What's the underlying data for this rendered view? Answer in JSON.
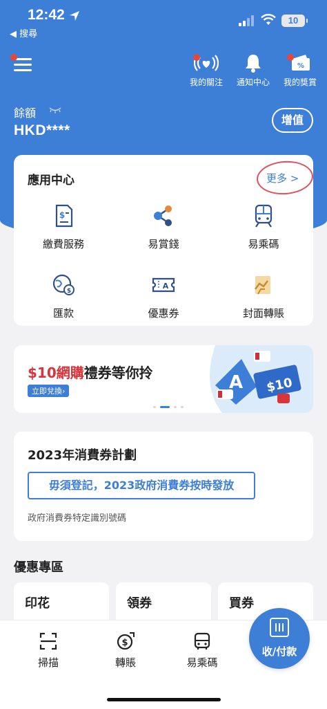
{
  "status_bar": {
    "time": "12:42",
    "back_label": "◀ 搜尋",
    "battery": "10"
  },
  "header": {
    "items": [
      {
        "label": "我的關注",
        "icon": "heart-broadcast-icon"
      },
      {
        "label": "通知中心",
        "icon": "bell-icon"
      },
      {
        "label": "我的獎賞",
        "icon": "coupon-icon"
      }
    ]
  },
  "balance": {
    "label": "餘額",
    "value": "HKD****",
    "topup_label": "增值"
  },
  "app_center": {
    "title": "應用中心",
    "more_label": "更多 >",
    "items": [
      {
        "label": "繳費服務",
        "icon": "bill-icon"
      },
      {
        "label": "易賞錢",
        "icon": "share-nodes-icon"
      },
      {
        "label": "易乘碼",
        "icon": "train-icon"
      },
      {
        "label": "匯款",
        "icon": "globe-money-icon"
      },
      {
        "label": "優惠券",
        "icon": "ticket-icon"
      },
      {
        "label": "封面轉賬",
        "icon": "envelope-transfer-icon"
      }
    ]
  },
  "banner": {
    "title_highlight": "$10網購",
    "title_rest": "禮券等你拎",
    "tag": "立即兌換›",
    "art_text": "$10"
  },
  "voucher_plan": {
    "title": "2023年消費券計劃",
    "button_label": "毋須登記，2023政府消費券按時發放",
    "subtitle": "政府消費券特定識別號碼"
  },
  "promo": {
    "title": "優惠專區",
    "cards": [
      "印花",
      "領券",
      "買券"
    ]
  },
  "bottom_nav": {
    "items": [
      {
        "label": "掃描",
        "icon": "scan-icon"
      },
      {
        "label": "轉賬",
        "icon": "transfer-icon"
      },
      {
        "label": "易乘碼",
        "icon": "bus-icon"
      }
    ],
    "pay_label": "收/付款"
  },
  "colors": {
    "primary": "#3d7ed6",
    "accent_red": "#d8343c",
    "badge_red": "#e2493c"
  }
}
